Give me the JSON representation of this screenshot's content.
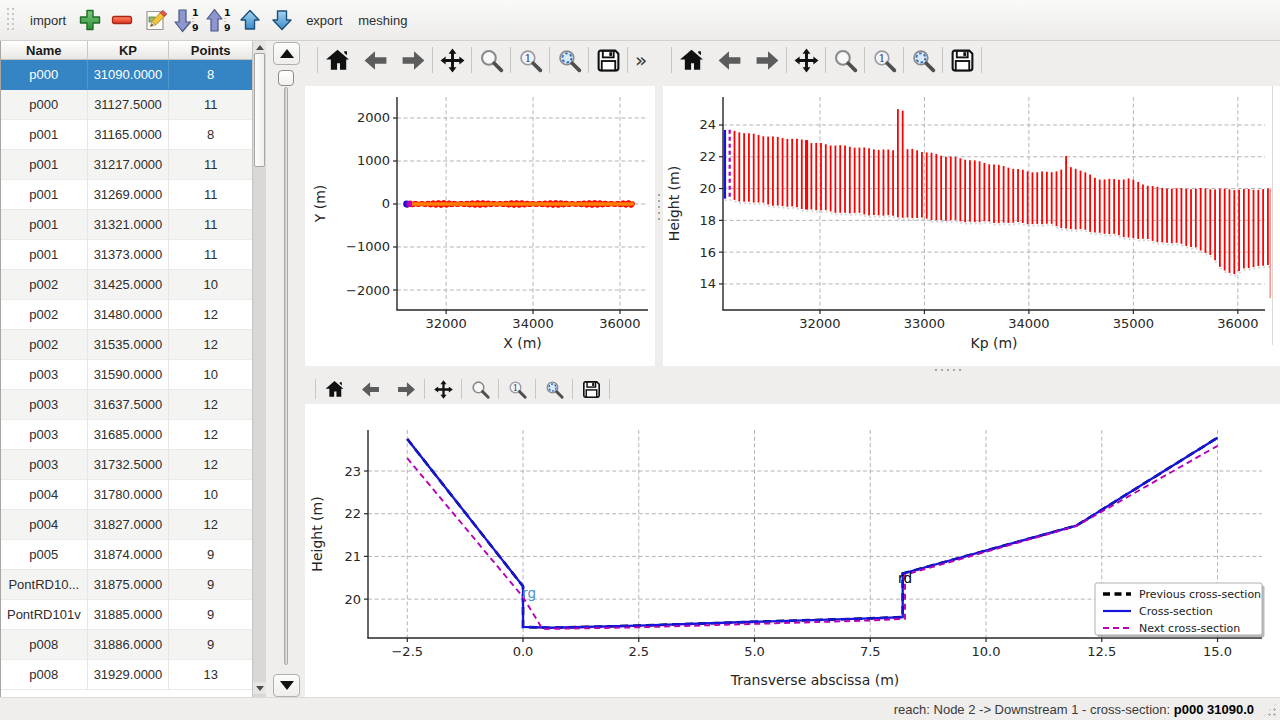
{
  "toolbar": {
    "items": [
      {
        "type": "menu",
        "label": "import",
        "name": "import-menu"
      },
      {
        "type": "button",
        "icon": "add-icon",
        "name": "add-section-button"
      },
      {
        "type": "button",
        "icon": "remove-icon",
        "name": "remove-section-button"
      },
      {
        "type": "button",
        "icon": "edit-icon",
        "name": "edit-section-button"
      },
      {
        "type": "button",
        "icon": "sort-descending-icon",
        "name": "sort-descending-button"
      },
      {
        "type": "button",
        "icon": "sort-ascending-icon",
        "name": "sort-ascending-button"
      },
      {
        "type": "button",
        "icon": "move-up-icon",
        "name": "move-up-button"
      },
      {
        "type": "button",
        "icon": "move-down-icon",
        "name": "move-down-button"
      },
      {
        "type": "menu",
        "label": "export",
        "name": "export-menu"
      },
      {
        "type": "menu",
        "label": "meshing",
        "name": "meshing-menu"
      }
    ]
  },
  "table": {
    "columns": [
      "Name",
      "KP",
      "Points"
    ],
    "selected_index": 0,
    "rows": [
      [
        "p000",
        "31090.0000",
        "8"
      ],
      [
        "p000",
        "31127.5000",
        "11"
      ],
      [
        "p001",
        "31165.0000",
        "8"
      ],
      [
        "p001",
        "31217.0000",
        "11"
      ],
      [
        "p001",
        "31269.0000",
        "11"
      ],
      [
        "p001",
        "31321.0000",
        "11"
      ],
      [
        "p001",
        "31373.0000",
        "11"
      ],
      [
        "p002",
        "31425.0000",
        "10"
      ],
      [
        "p002",
        "31480.0000",
        "12"
      ],
      [
        "p002",
        "31535.0000",
        "12"
      ],
      [
        "p003",
        "31590.0000",
        "10"
      ],
      [
        "p003",
        "31637.5000",
        "12"
      ],
      [
        "p003",
        "31685.0000",
        "12"
      ],
      [
        "p003",
        "31732.5000",
        "12"
      ],
      [
        "p004",
        "31780.0000",
        "10"
      ],
      [
        "p004",
        "31827.0000",
        "12"
      ],
      [
        "p005",
        "31874.0000",
        "9"
      ],
      [
        "PontRD10...",
        "31875.0000",
        "9"
      ],
      [
        "PontRD101v",
        "31885.0000",
        "9"
      ],
      [
        "p008",
        "31886.0000",
        "9"
      ],
      [
        "p008",
        "31929.0000",
        "13"
      ]
    ]
  },
  "mpl_toolbars": {
    "fig1": [
      "home",
      "back",
      "forward",
      "pan",
      "zoom",
      "zoom-one",
      "zoom-fit",
      "save",
      "more"
    ],
    "fig2": [
      "home",
      "back",
      "forward",
      "pan",
      "zoom",
      "zoom-one",
      "zoom-fit",
      "save"
    ],
    "fig3": [
      "home",
      "back",
      "forward",
      "pan",
      "zoom",
      "zoom-one",
      "zoom-fit",
      "save"
    ]
  },
  "statusbar": {
    "reach_label": "reach: Node 2 -> Downstream 1 - cross-section: ",
    "current_section": "p000 31090.0"
  },
  "colors": {
    "selection": "#3d8bc4",
    "bar_red": "#ff0000",
    "axis_orange": "#ff8000",
    "current_blue": "#1515dd",
    "next_magenta": "#b800b8",
    "previous_black": "#000000",
    "rg_label_blue": "#4a90c8"
  },
  "chart_data": [
    {
      "id": "trace_plan",
      "type": "scatter",
      "xlabel": "X (m)",
      "ylabel": "Y (m)",
      "xticks": [
        32000,
        34000,
        36000
      ],
      "yticks": [
        -2000,
        -1000,
        0,
        1000,
        2000
      ],
      "xlim": [
        30870,
        36645
      ],
      "ylim": [
        -2465,
        2488
      ],
      "points": {
        "x_start": 31090,
        "x_end": 36290,
        "y_center": 0,
        "band_halfwidth": 45,
        "color": "#ff0000"
      },
      "axis_line": {
        "color": "#ff8000",
        "y": 0
      },
      "first_point": {
        "x": 31090,
        "y": 0,
        "color": "#1515dd"
      },
      "next_point": {
        "x": 31150,
        "y": 0,
        "color": "#b800b8"
      }
    },
    {
      "id": "profile_envelope",
      "type": "rangebars",
      "xlabel": "Kp (m)",
      "ylabel": "Height (m)",
      "xticks": [
        32000,
        33000,
        34000,
        35000,
        36000
      ],
      "yticks": [
        14,
        16,
        18,
        20,
        22,
        24
      ],
      "xlim": [
        31072,
        36260
      ],
      "ylim": [
        12.36,
        25.76
      ],
      "kp_start": 31090,
      "kp_end": 36290,
      "kp_step": 46,
      "bar_color": "#ff0000",
      "top_envelope": [
        [
          31090,
          23.65
        ],
        [
          31400,
          23.4
        ],
        [
          31700,
          23.2
        ],
        [
          31860,
          23.05
        ],
        [
          31900,
          22.9
        ],
        [
          32100,
          22.7
        ],
        [
          32400,
          22.55
        ],
        [
          32700,
          22.45
        ],
        [
          32900,
          22.5
        ],
        [
          33000,
          22.3
        ],
        [
          33200,
          22.0
        ],
        [
          33500,
          21.7
        ],
        [
          33800,
          21.4
        ],
        [
          34000,
          21.1
        ],
        [
          34200,
          21.0
        ],
        [
          34420,
          21.3
        ],
        [
          34500,
          21.1
        ],
        [
          34650,
          20.6
        ],
        [
          34850,
          20.6
        ],
        [
          34950,
          20.7
        ],
        [
          35100,
          20.3
        ],
        [
          35250,
          20.05
        ],
        [
          35400,
          19.95
        ],
        [
          35600,
          19.95
        ],
        [
          35900,
          19.98
        ],
        [
          36290,
          20.0
        ]
      ],
      "bottom_envelope": [
        [
          31090,
          19.35
        ],
        [
          31400,
          19.1
        ],
        [
          31700,
          18.85
        ],
        [
          31900,
          18.7
        ],
        [
          32100,
          18.55
        ],
        [
          32400,
          18.4
        ],
        [
          32700,
          18.25
        ],
        [
          32900,
          18.15
        ],
        [
          33000,
          18.1
        ],
        [
          33200,
          18.0
        ],
        [
          33500,
          17.9
        ],
        [
          33800,
          17.85
        ],
        [
          34000,
          17.8
        ],
        [
          34200,
          17.75
        ],
        [
          34350,
          17.5
        ],
        [
          34500,
          17.4
        ],
        [
          34700,
          17.2
        ],
        [
          34900,
          17.0
        ],
        [
          35100,
          16.8
        ],
        [
          35250,
          16.65
        ],
        [
          35400,
          16.55
        ],
        [
          35600,
          16.3
        ],
        [
          35750,
          15.7
        ],
        [
          35850,
          14.95
        ],
        [
          35950,
          14.6
        ],
        [
          36050,
          14.9
        ],
        [
          36150,
          15.1
        ],
        [
          36290,
          15.2
        ]
      ],
      "spikes": [
        {
          "kp": 32750,
          "top": 25.0
        },
        {
          "kp": 32795,
          "top": 24.9
        },
        {
          "kp": 34350,
          "top": 22.05
        }
      ],
      "bold_bars": [
        {
          "kp": 31872,
          "top": 23.05
        }
      ],
      "first_bar": {
        "kp": 31090,
        "color": "#1515dd"
      },
      "next_bar": {
        "kp": 31130,
        "color": "#b800b8",
        "dashed": true
      },
      "last_bar": {
        "kp": 36290,
        "top": 20.0,
        "bottom": 13.1
      }
    },
    {
      "id": "cross_section",
      "type": "line",
      "xlabel": "Transverse abscissa (m)",
      "ylabel": "Height (m)",
      "xticks": [
        -2.5,
        0.0,
        2.5,
        5.0,
        7.5,
        10.0,
        12.5,
        15.0
      ],
      "yticks": [
        20,
        21,
        22,
        23
      ],
      "xlim": [
        -3.348,
        15.96
      ],
      "ylim": [
        19.09,
        23.96
      ],
      "series": [
        {
          "name": "Previous cross-section",
          "color": "#000000",
          "dash": "8,5",
          "width": 2.6,
          "points": [
            [
              -2.5,
              23.75
            ],
            [
              0,
              20.3
            ],
            [
              0,
              19.35
            ],
            [
              0.6,
              19.33
            ],
            [
              2.5,
              19.38
            ],
            [
              5,
              19.47
            ],
            [
              7.5,
              19.55
            ],
            [
              8.2,
              19.58
            ],
            [
              8.2,
              20.6
            ],
            [
              11.95,
              21.72
            ],
            [
              15,
              23.78
            ]
          ]
        },
        {
          "name": "Cross-section",
          "color": "#1515dd",
          "dash": null,
          "width": 2.3,
          "points": [
            [
              -2.5,
              23.75
            ],
            [
              0,
              20.3
            ],
            [
              0,
              19.35
            ],
            [
              0.6,
              19.33
            ],
            [
              2.5,
              19.38
            ],
            [
              5,
              19.47
            ],
            [
              7.5,
              19.55
            ],
            [
              8.2,
              19.58
            ],
            [
              8.2,
              20.6
            ],
            [
              11.95,
              21.72
            ],
            [
              15,
              23.78
            ]
          ]
        },
        {
          "name": "Next cross-section",
          "color": "#b800b8",
          "dash": "6,4",
          "width": 1.9,
          "points": [
            [
              -2.5,
              23.3
            ],
            [
              0,
              20.05
            ],
            [
              0.42,
              19.3
            ],
            [
              2.5,
              19.34
            ],
            [
              5,
              19.42
            ],
            [
              7.5,
              19.5
            ],
            [
              8.25,
              19.54
            ],
            [
              8.25,
              20.57
            ],
            [
              11.95,
              21.71
            ],
            [
              15,
              23.59
            ]
          ]
        }
      ],
      "annotations": [
        {
          "text": "rg",
          "x": -0.02,
          "y": 20.02,
          "color": "#4a90c8"
        },
        {
          "text": "rd",
          "x": 8.1,
          "y": 20.38,
          "color": "#000000"
        }
      ],
      "legend": {
        "entries": [
          "Previous cross-section",
          "Cross-section",
          "Next cross-section"
        ],
        "position": "lower right"
      }
    }
  ]
}
